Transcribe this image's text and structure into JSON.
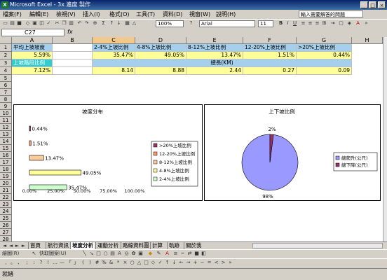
{
  "window": {
    "title": "Microsoft Excel - 3x 進度 製作",
    "controls": [
      "_",
      "□",
      "×"
    ]
  },
  "menu": {
    "items": [
      "檔案(F)",
      "編輯(E)",
      "檢視(V)",
      "插入(I)",
      "格式(O)",
      "工具(T)",
      "資料(D)",
      "視窗(W)",
      "說明(H)"
    ],
    "help_placeholder": "輸入需要解答的問題"
  },
  "toolbar": {
    "zoom": "100%",
    "font": "Arial",
    "font_size": "11"
  },
  "formula_bar": {
    "name_box": "C27",
    "fx": "fx"
  },
  "sheet": {
    "columns": [
      "A",
      "B",
      "C",
      "D",
      "E",
      "F",
      "G",
      "H"
    ],
    "rows": [
      "1",
      "2",
      "3",
      "4",
      "5",
      "6",
      "7",
      "8",
      "9",
      "10",
      "11",
      "12",
      "13",
      "14",
      "15",
      "16",
      "17",
      "18",
      "19",
      "20",
      "21",
      "22",
      "23",
      "24",
      "25",
      "26",
      "27",
      "28",
      "29"
    ],
    "cells": {
      "a1": "平均上坡坡度",
      "a2": "5.59%",
      "a3": "上坡路段比例",
      "a4": "7.12%",
      "c1": "2-4%上坡比例",
      "d1": "4-8%上坡比例",
      "e1": "8-12%上坡比例",
      "f1": "12-20%上坡比例",
      "g1": ">20%上坡比例",
      "c2": "35.47%",
      "d2": "49.05%",
      "e2": "13.47%",
      "f2": "1.51%",
      "g2": "0.44%",
      "e3": "總長(KM)",
      "c4": "8.14",
      "d4": "8.88",
      "e4": "2.44",
      "f4": "0.27",
      "g4": "0.09"
    }
  },
  "chart_data": [
    {
      "type": "bar",
      "orientation": "horizontal",
      "title": "坡度分布",
      "categories": [
        ">20%上坡比例",
        "12-20%上坡比例",
        "8-12%上坡比例",
        "4-8%上坡比例",
        "2-4%上坡比例"
      ],
      "values": [
        0.44,
        1.51,
        13.47,
        49.05,
        35.47
      ],
      "data_labels": [
        "0.44%",
        "1.51%",
        "13.47%",
        "49.05%",
        "35.47%"
      ],
      "colors": [
        "#993366",
        "#ff9966",
        "#ffcc99",
        "#ffff99",
        "#ccffcc"
      ],
      "xticks": [
        "0.00%",
        "25.00%",
        "50.00%",
        "75.00%",
        "100.00%"
      ],
      "xlim": [
        0,
        100
      ],
      "legend": "right"
    },
    {
      "type": "pie",
      "title": "上下坡比例",
      "categories": [
        "總爬升(公尺)",
        "總下降(公尺)"
      ],
      "values": [
        98,
        2
      ],
      "data_labels": [
        "98%",
        "2%"
      ],
      "colors": [
        "#9999ff",
        "#993366"
      ],
      "legend": "right"
    }
  ],
  "sheet_tabs": [
    "首頁",
    "航行資訊",
    "坡度分析",
    "運動分析",
    "路線資料圖",
    "計算",
    "軌跡",
    "關於我"
  ],
  "active_tab": "坡度分析",
  "draw_toolbar": {
    "draw_label": "繪圖(R)",
    "autoshape_label": "快取圖案(U)"
  },
  "status": "就緒"
}
